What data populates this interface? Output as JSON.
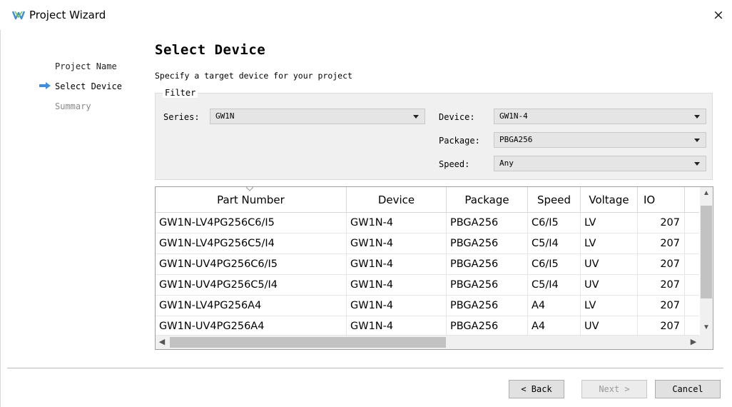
{
  "window": {
    "title": "Project Wizard",
    "close_glyph": "×"
  },
  "icons": {
    "app": "gowin-logo-icon",
    "close": "close-icon",
    "current_step": "arrow-right-icon"
  },
  "colors": {
    "accent": "#3d8ee0",
    "filter_bg": "#f0f0f0",
    "scrollbar_thumb": "#c2c2c2"
  },
  "nav": {
    "steps": [
      {
        "label": "Project Name",
        "state": "done"
      },
      {
        "label": "Select Device",
        "state": "current"
      },
      {
        "label": "Summary",
        "state": "future"
      }
    ]
  },
  "page": {
    "heading": "Select Device",
    "subtitle": "Specify a target device for your project"
  },
  "filter": {
    "legend": "Filter",
    "series_label": "Series:",
    "series_value": "GW1N",
    "device_label": "Device:",
    "device_value": "GW1N-4",
    "package_label": "Package:",
    "package_value": "PBGA256",
    "speed_label": "Speed:",
    "speed_value": "Any"
  },
  "table": {
    "columns": [
      "Part Number",
      "Device",
      "Package",
      "Speed",
      "Voltage",
      "IO"
    ],
    "rows": [
      [
        "GW1N-LV4PG256C6/I5",
        "GW1N-4",
        "PBGA256",
        "C6/I5",
        "LV",
        "207"
      ],
      [
        "GW1N-LV4PG256C5/I4",
        "GW1N-4",
        "PBGA256",
        "C5/I4",
        "LV",
        "207"
      ],
      [
        "GW1N-UV4PG256C6/I5",
        "GW1N-4",
        "PBGA256",
        "C6/I5",
        "UV",
        "207"
      ],
      [
        "GW1N-UV4PG256C5/I4",
        "GW1N-4",
        "PBGA256",
        "C5/I4",
        "UV",
        "207"
      ],
      [
        "GW1N-LV4PG256A4",
        "GW1N-4",
        "PBGA256",
        "A4",
        "LV",
        "207"
      ],
      [
        "GW1N-UV4PG256A4",
        "GW1N-4",
        "PBGA256",
        "A4",
        "UV",
        "207"
      ]
    ]
  },
  "buttons": {
    "back": "< Back",
    "next": "Next >",
    "cancel": "Cancel"
  }
}
